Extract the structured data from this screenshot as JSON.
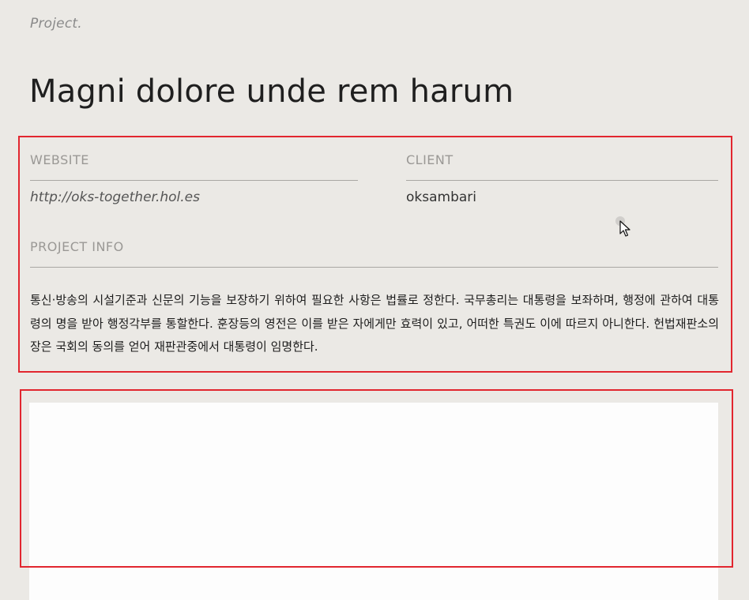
{
  "header": {
    "eyebrow": "Project.",
    "title": "Magni dolore unde rem harum"
  },
  "details": {
    "website_label": "WEBSITE",
    "website_value": "http://oks-together.hol.es",
    "client_label": "CLIENT",
    "client_value": "oksambari",
    "project_info_label": "PROJECT INFO",
    "project_info_text": "통신·방송의 시설기준과 신문의 기능을 보장하기 위하여 필요한 사항은 법률로 정한다. 국무총리는 대통령을 보좌하며, 행정에 관하여 대통령의 명을 받아 행정각부를 통할한다. 훈장등의 영전은 이를 받은 자에게만 효력이 있고, 어떠한 특권도 이에 따르지 아니한다. 헌법재판소의 장은 국회의 동의를 얻어 재판관중에서 대통령이 임명한다."
  },
  "cursor": {
    "icon": "arrow-pointer-icon"
  },
  "colors": {
    "background": "#ebe9e5",
    "highlight_box": "#e2262f",
    "image_panel": "#fdfdfd"
  }
}
